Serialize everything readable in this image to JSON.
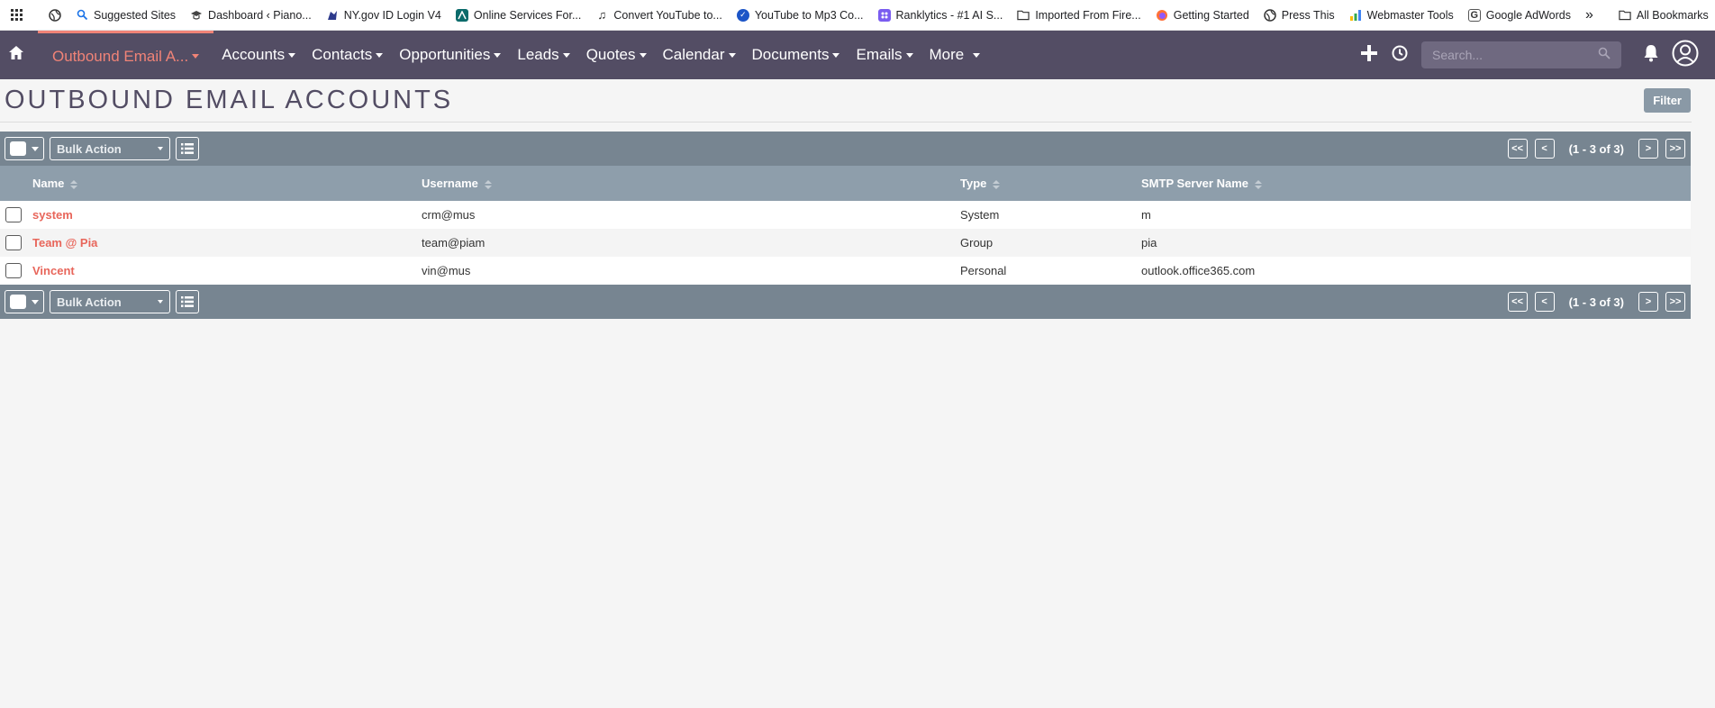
{
  "bookmarks": [
    {
      "label": "",
      "icon": "apps-icon"
    },
    {
      "label": "",
      "icon": "globe-icon"
    },
    {
      "label": "Suggested Sites",
      "icon": "search-icon"
    },
    {
      "label": "Dashboard ‹ Piano...",
      "icon": "cap-icon"
    },
    {
      "label": "NY.gov ID Login V4",
      "icon": "ny-icon"
    },
    {
      "label": "Online Services For...",
      "icon": "bank-icon"
    },
    {
      "label": "Convert YouTube to...",
      "icon": "music-icon"
    },
    {
      "label": "YouTube to Mp3 Co...",
      "icon": "check-icon"
    },
    {
      "label": "Ranklytics - #1 AI S...",
      "icon": "grid-icon"
    },
    {
      "label": "Imported From Fire...",
      "icon": "folder-icon"
    },
    {
      "label": "Getting Started",
      "icon": "firefox-icon"
    },
    {
      "label": "Press This",
      "icon": "globe-icon"
    },
    {
      "label": "Webmaster Tools",
      "icon": "chart-icon"
    },
    {
      "label": "Google AdWords",
      "icon": "g-icon"
    }
  ],
  "bookmarks_more": "»",
  "bookmarks_all": "All Bookmarks",
  "nav": {
    "active": "Outbound Email A...",
    "items": [
      "Accounts",
      "Contacts",
      "Opportunities",
      "Leads",
      "Quotes",
      "Calendar",
      "Documents",
      "Emails",
      "More"
    ],
    "search_placeholder": "Search..."
  },
  "page": {
    "title": "OUTBOUND EMAIL ACCOUNTS",
    "filter_label": "Filter"
  },
  "actionbar": {
    "bulk_label": "Bulk Action",
    "first": "<<",
    "prev": "<",
    "range": "(1 - 3 of 3)",
    "next": ">",
    "last": ">>"
  },
  "table": {
    "headers": [
      "Name",
      "Username",
      "Type",
      "SMTP Server Name"
    ],
    "rows": [
      {
        "name": "system",
        "username": "crm@mus",
        "type": "System",
        "smtp": "m"
      },
      {
        "name": "Team @ Pia",
        "username": "team@piam",
        "type": "Group",
        "smtp": "pia"
      },
      {
        "name": "Vincent",
        "username": "vin@mus",
        "type": "Personal",
        "smtp": "outlook.office365.com"
      }
    ]
  },
  "colors": {
    "nav_bg": "#534d64",
    "accent": "#f08377",
    "actionbar_bg": "#778591",
    "header_bg": "#8e9eab",
    "link": "#e8665b"
  }
}
